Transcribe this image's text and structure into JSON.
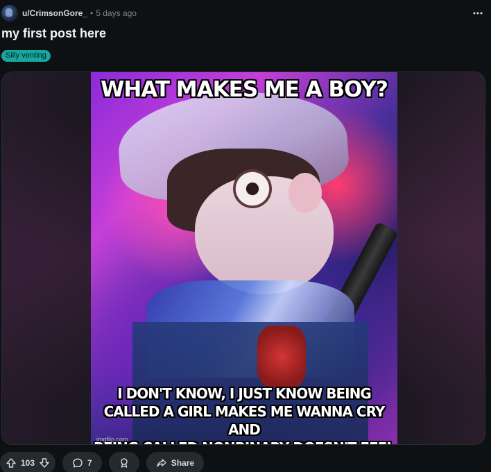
{
  "post": {
    "author": "u/CrimsonGore_",
    "separator": "•",
    "time": "5 days ago",
    "title": "my first post here",
    "flair": "Silly venting"
  },
  "media": {
    "meme_top_text": "WHAT MAKES ME A BOY?",
    "meme_bottom_text": "I DON'T KNOW, I JUST KNOW BEING\nCALLED A GIRL MAKES ME WANNA CRY AND\nBEING CALLED NONBINARY DOESN'T FEEL RIGHT",
    "watermark": "imgflip.com"
  },
  "actions": {
    "upvotes": "103",
    "comments": "7",
    "share_label": "Share"
  },
  "icons": {
    "more": "more-options-icon",
    "upvote": "upvote-arrow-icon",
    "downvote": "downvote-arrow-icon",
    "comment": "comment-bubble-icon",
    "award": "award-icon",
    "share": "share-arrow-icon"
  },
  "colors": {
    "background": "#0e1113",
    "flair": "#14a8a0",
    "pill": "#272a2d"
  }
}
